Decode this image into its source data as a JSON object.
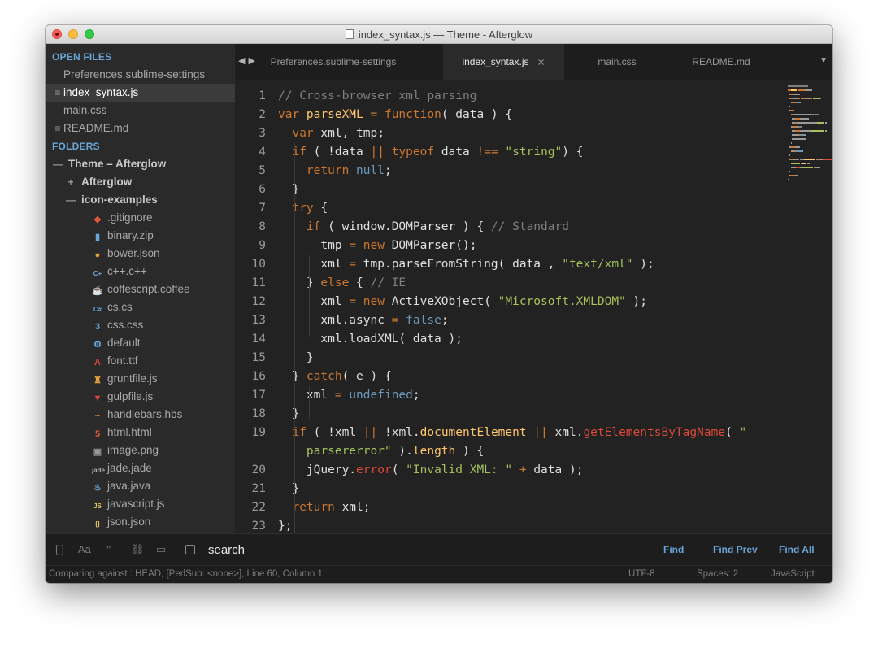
{
  "window": {
    "title": "index_syntax.js — Theme - Afterglow"
  },
  "sidebar": {
    "open_files_header": "OPEN FILES",
    "open_files": [
      {
        "label": "Preferences.sublime-settings",
        "active": false,
        "icon": ""
      },
      {
        "label": "index_syntax.js",
        "active": true,
        "icon": "≡"
      },
      {
        "label": "main.css",
        "active": false,
        "icon": ""
      },
      {
        "label": "README.md",
        "active": false,
        "icon": "≡"
      }
    ],
    "folders_header": "FOLDERS",
    "folders": [
      {
        "label": "Theme – Afterglow",
        "glyph": "—"
      },
      {
        "label": "Afterglow",
        "glyph": "+"
      },
      {
        "label": "icon-examples",
        "glyph": "—"
      }
    ],
    "files": [
      {
        "label": ".gitignore",
        "icon": "git-icon",
        "glyph": "◆",
        "color": "#e0583b"
      },
      {
        "label": "binary.zip",
        "icon": "zip-icon",
        "glyph": "▮",
        "color": "#6aa6d8"
      },
      {
        "label": "bower.json",
        "icon": "bower-icon",
        "glyph": "●",
        "color": "#e6a23c"
      },
      {
        "label": "c++.c++",
        "icon": "cpp-icon",
        "glyph": "C+",
        "color": "#6aa6d8"
      },
      {
        "label": "coffescript.coffee",
        "icon": "coffee-icon",
        "glyph": "☕",
        "color": "#c8843c"
      },
      {
        "label": "cs.cs",
        "icon": "csharp-icon",
        "glyph": "C#",
        "color": "#6aa6d8"
      },
      {
        "label": "css.css",
        "icon": "css-icon",
        "glyph": "3",
        "color": "#6aa6d8"
      },
      {
        "label": "default",
        "icon": "gear-icon",
        "glyph": "⚙",
        "color": "#6aa6d8"
      },
      {
        "label": "font.ttf",
        "icon": "font-icon",
        "glyph": "A",
        "color": "#da4939"
      },
      {
        "label": "gruntfile.js",
        "icon": "grunt-icon",
        "glyph": "♜",
        "color": "#e6a23c"
      },
      {
        "label": "gulpfile.js",
        "icon": "gulp-icon",
        "glyph": "▼",
        "color": "#da4939"
      },
      {
        "label": "handlebars.hbs",
        "icon": "handlebars-icon",
        "glyph": "~",
        "color": "#c8843c"
      },
      {
        "label": "html.html",
        "icon": "html-icon",
        "glyph": "5",
        "color": "#e0583b"
      },
      {
        "label": "image.png",
        "icon": "image-icon",
        "glyph": "▣",
        "color": "#9a9a9a"
      },
      {
        "label": "jade.jade",
        "icon": "jade-icon",
        "glyph": "jade",
        "color": "#b0b0b0"
      },
      {
        "label": "java.java",
        "icon": "java-icon",
        "glyph": "♨",
        "color": "#6aa6d8"
      },
      {
        "label": "javascript.js",
        "icon": "js-icon",
        "glyph": "JS",
        "color": "#e6c85c"
      },
      {
        "label": "json.json",
        "icon": "json-icon",
        "glyph": "{}",
        "color": "#e6c85c"
      }
    ]
  },
  "tabs": [
    {
      "label": "Preferences.sublime-settings"
    },
    {
      "label": "index_syntax.js",
      "close": "⨯"
    },
    {
      "label": "main.css"
    },
    {
      "label": "README.md"
    }
  ],
  "line_numbers": [
    "1",
    "2",
    "3",
    "4",
    "5",
    "6",
    "7",
    "8",
    "9",
    "10",
    "11",
    "12",
    "13",
    "14",
    "15",
    "16",
    "17",
    "18",
    "19",
    "",
    "20",
    "21",
    "22",
    "23"
  ],
  "findbar": {
    "search_value": "search",
    "find_label": "Find",
    "find_prev_label": "Find Prev",
    "find_all_label": "Find All",
    "option_icons": [
      "[ ]",
      "Aa",
      "”",
      "⛓",
      "▭"
    ]
  },
  "statusbar": {
    "left": "Comparing against : HEAD, [PerlSub: <none>], Line 60, Column 1",
    "encoding": "UTF-8",
    "indent": "Spaces: 2",
    "syntax": "JavaScript"
  },
  "colors": {
    "accent": "#6aa6d8",
    "background": "#222222",
    "keyword": "#cc7832",
    "string": "#a5c25c",
    "function": "#ffc66d",
    "constant": "#6c99bb",
    "comment": "#7f7f7f"
  },
  "code": [
    [
      [
        "c-com",
        "// Cross-browser xml parsing"
      ]
    ],
    [
      [
        "c-kw",
        "var "
      ],
      [
        "c-fn",
        "parseXML"
      ],
      [
        "c-op",
        " = "
      ],
      [
        "c-kw",
        "function"
      ],
      [
        "",
        "( data ) {"
      ]
    ],
    [
      [
        "",
        "  "
      ],
      [
        "c-kw",
        "var "
      ],
      [
        "",
        "xml, tmp;"
      ]
    ],
    [
      [
        "",
        "  "
      ],
      [
        "c-kw",
        "if "
      ],
      [
        "",
        "( !data "
      ],
      [
        "c-op",
        "||"
      ],
      [
        "c-kw",
        " typeof "
      ],
      [
        "",
        "data "
      ],
      [
        "c-op",
        "!=="
      ],
      [
        "c-str",
        " \"string\""
      ],
      [
        "",
        ") {"
      ]
    ],
    [
      [
        "",
        "    "
      ],
      [
        "c-kw",
        "return "
      ],
      [
        "c-cst",
        "null"
      ],
      [
        "",
        ";"
      ]
    ],
    [
      [
        "",
        "  }"
      ]
    ],
    [
      [
        "",
        "  "
      ],
      [
        "c-kw",
        "try "
      ],
      [
        "",
        "{"
      ]
    ],
    [
      [
        "",
        "    "
      ],
      [
        "c-kw",
        "if "
      ],
      [
        "",
        "( window.DOMParser ) { "
      ],
      [
        "c-com",
        "// Standard"
      ]
    ],
    [
      [
        "",
        "      tmp "
      ],
      [
        "c-op",
        "= "
      ],
      [
        "c-kw",
        "new "
      ],
      [
        "",
        "DOMParser();"
      ]
    ],
    [
      [
        "",
        "      xml "
      ],
      [
        "c-op",
        "= "
      ],
      [
        "",
        "tmp.parseFromString( data , "
      ],
      [
        "c-str",
        "\"text/xml\""
      ],
      [
        "",
        " );"
      ]
    ],
    [
      [
        "",
        "    } "
      ],
      [
        "c-kw",
        "else "
      ],
      [
        "",
        "{ "
      ],
      [
        "c-com",
        "// IE"
      ]
    ],
    [
      [
        "",
        "      xml "
      ],
      [
        "c-op",
        "= "
      ],
      [
        "c-kw",
        "new "
      ],
      [
        "",
        "ActiveXObject( "
      ],
      [
        "c-str",
        "\"Microsoft.XMLDOM\""
      ],
      [
        "",
        " );"
      ]
    ],
    [
      [
        "",
        "      xml.async "
      ],
      [
        "c-op",
        "= "
      ],
      [
        "c-cst",
        "false"
      ],
      [
        "",
        ";"
      ]
    ],
    [
      [
        "",
        "      xml.loadXML( data );"
      ]
    ],
    [
      [
        "",
        "    }"
      ]
    ],
    [
      [
        "",
        "  } "
      ],
      [
        "c-kw",
        "catch"
      ],
      [
        "",
        "( e ) {"
      ]
    ],
    [
      [
        "",
        "    xml "
      ],
      [
        "c-op",
        "= "
      ],
      [
        "c-cst",
        "undefined"
      ],
      [
        "",
        ";"
      ]
    ],
    [
      [
        "",
        "  }"
      ]
    ],
    [
      [
        "",
        "  "
      ],
      [
        "c-kw",
        "if "
      ],
      [
        "",
        "( !xml "
      ],
      [
        "c-op",
        "||"
      ],
      [
        "",
        " !xml."
      ],
      [
        "c-prop",
        "documentElement"
      ],
      [
        "",
        " "
      ],
      [
        "c-op",
        "||"
      ],
      [
        "",
        " xml."
      ],
      [
        "c-mth",
        "getElementsByTagName"
      ],
      [
        "",
        "( "
      ],
      [
        "c-str",
        "\""
      ]
    ],
    [
      [
        "c-str",
        "    parsererror\""
      ],
      [
        "",
        " )."
      ],
      [
        "c-prop",
        "length"
      ],
      [
        "",
        " ) {"
      ]
    ],
    [
      [
        "",
        "    jQuery."
      ],
      [
        "c-mth",
        "error"
      ],
      [
        "",
        "( "
      ],
      [
        "c-str",
        "\"Invalid XML: \""
      ],
      [
        "c-op",
        " + "
      ],
      [
        "",
        "data );"
      ]
    ],
    [
      [
        "",
        "  }"
      ]
    ],
    [
      [
        "",
        "  "
      ],
      [
        "c-kw",
        "return "
      ],
      [
        "",
        "xml;"
      ]
    ],
    [
      [
        "",
        "};"
      ]
    ]
  ]
}
